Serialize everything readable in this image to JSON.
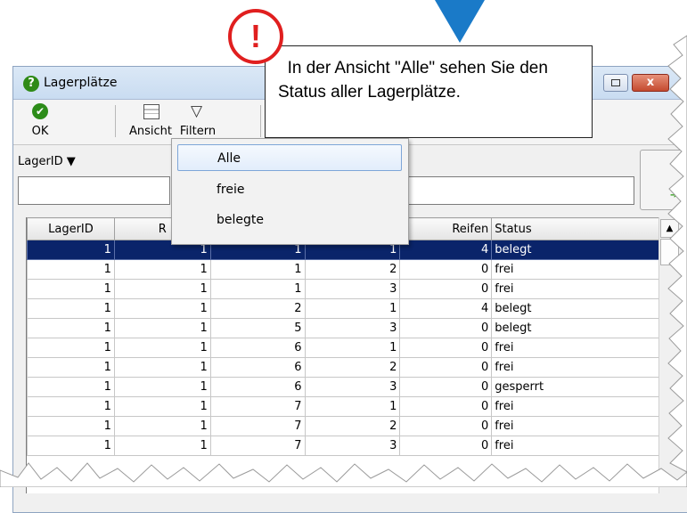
{
  "callout": {
    "badge": "!",
    "text": "  In der Ansicht \"Alle\" sehen Sie den Status aller Lagerplätze."
  },
  "window": {
    "title": "Lagerplätze",
    "title_icon": "question-icon",
    "close_label": "x"
  },
  "toolbar": {
    "ok_label": "OK",
    "ansicht_label": "Ansicht",
    "filtern_label": "Filtern"
  },
  "filter": {
    "lager_label": "LagerID ▼",
    "lager_value": "",
    "rest_value": ""
  },
  "dropdown": {
    "items": [
      "Alle",
      "freie",
      "belegte"
    ],
    "highlighted": "Alle"
  },
  "table": {
    "headers": [
      "LagerID",
      "R",
      "",
      "",
      "Reifen",
      "Status"
    ],
    "rows": [
      [
        "1",
        "1",
        "1",
        "1",
        "4",
        "belegt"
      ],
      [
        "1",
        "1",
        "1",
        "2",
        "0",
        "frei"
      ],
      [
        "1",
        "1",
        "1",
        "3",
        "0",
        "frei"
      ],
      [
        "1",
        "1",
        "2",
        "1",
        "4",
        "belegt"
      ],
      [
        "1",
        "1",
        "5",
        "3",
        "0",
        "belegt"
      ],
      [
        "1",
        "1",
        "6",
        "1",
        "0",
        "frei"
      ],
      [
        "1",
        "1",
        "6",
        "2",
        "0",
        "frei"
      ],
      [
        "1",
        "1",
        "6",
        "3",
        "0",
        "gesperrt"
      ],
      [
        "1",
        "1",
        "7",
        "1",
        "0",
        "frei"
      ],
      [
        "1",
        "1",
        "7",
        "2",
        "0",
        "frei"
      ],
      [
        "1",
        "1",
        "7",
        "3",
        "0",
        "frei"
      ]
    ],
    "selected_row": 0
  },
  "colors": {
    "arrow": "#1a7ac8",
    "badge": "#e01f1f",
    "selection": "#0a246a"
  }
}
